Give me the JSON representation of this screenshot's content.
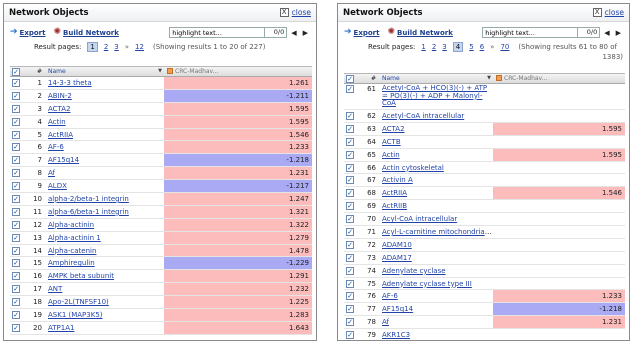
{
  "left": {
    "title": "Network Objects",
    "close_x": "X",
    "close_label": "close",
    "export_label": "Export",
    "build_label": "Build Network",
    "search_value": "highlight text...",
    "search_count": "0/0",
    "prev_arrow": "◀",
    "next_arrow": "▶",
    "pager_label": "Result pages:",
    "pages": [
      "1",
      "2",
      "3",
      "»",
      "12"
    ],
    "current_page_index": 0,
    "showing": "(Showing results 1 to 20 of 227)",
    "col_num": "#",
    "col_name": "Name",
    "col_val": "CRC-Madhav...",
    "rows": [
      {
        "n": "1",
        "name": "14-3-3 theta",
        "val": "1.261",
        "sign": "pos"
      },
      {
        "n": "2",
        "name": "ABIN-2",
        "val": "-1.211",
        "sign": "neg"
      },
      {
        "n": "3",
        "name": "ACTA2",
        "val": "1.595",
        "sign": "pos"
      },
      {
        "n": "4",
        "name": "Actin",
        "val": "1.595",
        "sign": "pos"
      },
      {
        "n": "5",
        "name": "ActRIIA",
        "val": "1.546",
        "sign": "pos"
      },
      {
        "n": "6",
        "name": "AF-6",
        "val": "1.233",
        "sign": "pos"
      },
      {
        "n": "7",
        "name": "AF15q14",
        "val": "-1.218",
        "sign": "neg"
      },
      {
        "n": "8",
        "name": "Af",
        "val": "1.231",
        "sign": "pos"
      },
      {
        "n": "9",
        "name": "ALDX",
        "val": "-1.217",
        "sign": "neg"
      },
      {
        "n": "10",
        "name": "alpha-2/beta-1 integrin",
        "val": "1.247",
        "sign": "pos"
      },
      {
        "n": "11",
        "name": "alpha-6/beta-1 integrin",
        "val": "1.321",
        "sign": "pos"
      },
      {
        "n": "12",
        "name": "Alpha-actinin",
        "val": "1.322",
        "sign": "pos"
      },
      {
        "n": "13",
        "name": "Alpha-actinin 1",
        "val": "1.279",
        "sign": "pos"
      },
      {
        "n": "14",
        "name": "Alpha-catenin",
        "val": "1.478",
        "sign": "pos"
      },
      {
        "n": "15",
        "name": "Amphiregulin",
        "val": "-1.229",
        "sign": "neg"
      },
      {
        "n": "16",
        "name": "AMPK beta subunit",
        "val": "1.291",
        "sign": "pos"
      },
      {
        "n": "17",
        "name": "ANT",
        "val": "1.232",
        "sign": "pos"
      },
      {
        "n": "18",
        "name": "Apo-2L(TNFSF10)",
        "val": "1.225",
        "sign": "pos"
      },
      {
        "n": "19",
        "name": "ASK1 (MAP3K5)",
        "val": "1.283",
        "sign": "pos"
      },
      {
        "n": "20",
        "name": "ATP1A1",
        "val": "1.643",
        "sign": "pos"
      }
    ]
  },
  "right": {
    "title": "Network Objects",
    "close_x": "X",
    "close_label": "close",
    "export_label": "Export",
    "build_label": "Build Network",
    "search_value": "highlight text...",
    "search_count": "0/0",
    "prev_arrow": "◀",
    "next_arrow": "▶",
    "pager_label": "Result pages:",
    "pages": [
      "1",
      "2",
      "3",
      "4",
      "5",
      "6",
      "»",
      "70"
    ],
    "current_page_index": 3,
    "showing": "(Showing results 61 to 80 of",
    "showing2": "1383)",
    "col_num": "#",
    "col_name": "Name",
    "col_val": "CRC-Madhav...",
    "rows": [
      {
        "n": "61",
        "name": "Acetyl-CoA + HCO(3)(-) + ATP = PO(3)(-) + ADP + Malonyl-CoA",
        "val": "",
        "sign": "none",
        "tall": true
      },
      {
        "n": "62",
        "name": "Acetyl-CoA intracellular",
        "val": "",
        "sign": "none"
      },
      {
        "n": "63",
        "name": "ACTA2",
        "val": "1.595",
        "sign": "pos"
      },
      {
        "n": "64",
        "name": "ACTB",
        "val": "",
        "sign": "none"
      },
      {
        "n": "65",
        "name": "Actin",
        "val": "1.595",
        "sign": "pos"
      },
      {
        "n": "66",
        "name": "Actin cytoskeletal",
        "val": "",
        "sign": "none"
      },
      {
        "n": "67",
        "name": "Activin A",
        "val": "",
        "sign": "none"
      },
      {
        "n": "68",
        "name": "ActRIIA",
        "val": "1.546",
        "sign": "pos"
      },
      {
        "n": "69",
        "name": "ActRIIB",
        "val": "",
        "sign": "none"
      },
      {
        "n": "70",
        "name": "Acyl-CoA intracellular",
        "val": "",
        "sign": "none"
      },
      {
        "n": "71",
        "name": "Acyl-L-carnitine mitochondrial matrix",
        "val": "",
        "sign": "none"
      },
      {
        "n": "72",
        "name": "ADAM10",
        "val": "",
        "sign": "none"
      },
      {
        "n": "73",
        "name": "ADAM17",
        "val": "",
        "sign": "none"
      },
      {
        "n": "74",
        "name": "Adenylate cyclase",
        "val": "",
        "sign": "none"
      },
      {
        "n": "75",
        "name": "Adenylate cyclase type III",
        "val": "",
        "sign": "none"
      },
      {
        "n": "76",
        "name": "AF-6",
        "val": "1.233",
        "sign": "pos"
      },
      {
        "n": "77",
        "name": "AF15q14",
        "val": "-1.218",
        "sign": "neg"
      },
      {
        "n": "78",
        "name": "Af",
        "val": "1.231",
        "sign": "pos"
      },
      {
        "n": "79",
        "name": "AKR1C3",
        "val": "",
        "sign": "none"
      },
      {
        "n": "80",
        "name": "AKT(PKB)",
        "val": "",
        "sign": "none"
      }
    ]
  }
}
